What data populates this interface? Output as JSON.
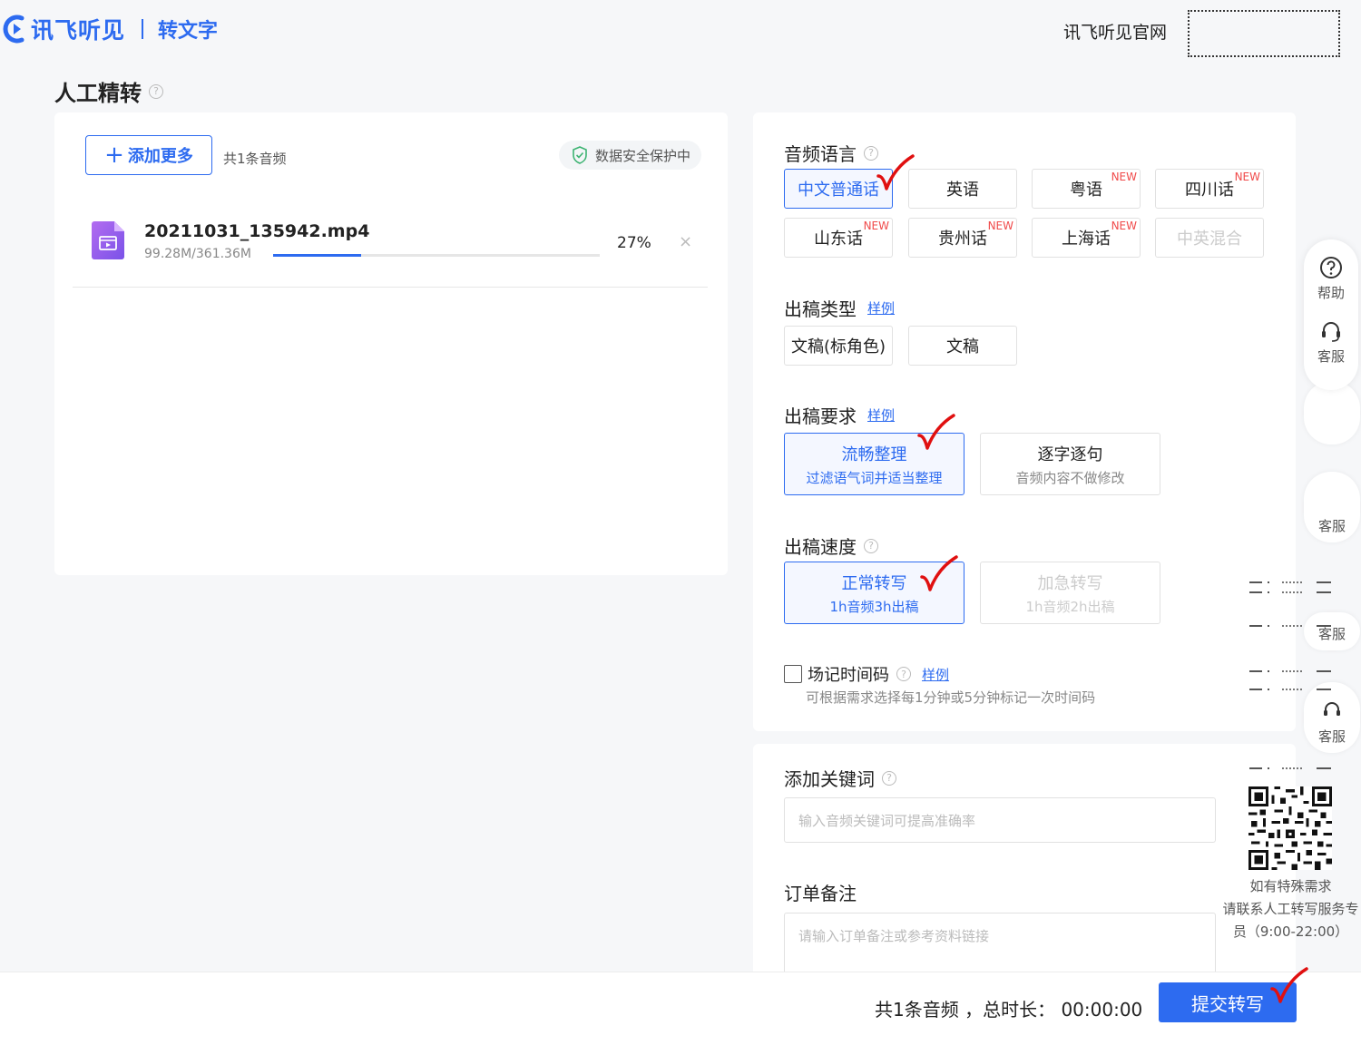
{
  "header": {
    "logo_text": "讯飞听见",
    "logo_sub": "转文字",
    "official_site": "讯飞听见官网"
  },
  "page": {
    "title": "人工精转",
    "help": "?"
  },
  "upload": {
    "add_more_plus": "+",
    "add_more": "添加更多",
    "count_label": "共1条音频",
    "secure_label": "数据安全保护中",
    "file": {
      "name": "20211031_135942.mp4",
      "size": "99.28M/361.36M",
      "progress_pct": "27%",
      "progress_value": 0.27,
      "close": "×"
    }
  },
  "audio_language": {
    "title": "音频语言",
    "help": "?",
    "options": [
      {
        "label": "中文普通话",
        "badge": ""
      },
      {
        "label": "英语",
        "badge": ""
      },
      {
        "label": "粤语",
        "badge": "NEW"
      },
      {
        "label": "四川话",
        "badge": "NEW"
      },
      {
        "label": "山东话",
        "badge": "NEW"
      },
      {
        "label": "贵州话",
        "badge": "NEW"
      },
      {
        "label": "上海话",
        "badge": "NEW"
      },
      {
        "label": "中英混合",
        "badge": ""
      }
    ]
  },
  "output_type": {
    "title": "出稿类型",
    "sample": "样例",
    "options": [
      "文稿(标角色)",
      "文稿"
    ]
  },
  "output_requirement": {
    "title": "出稿要求",
    "sample": "样例",
    "options": [
      {
        "title": "流畅整理",
        "sub": "过滤语气词并适当整理"
      },
      {
        "title": "逐字逐句",
        "sub": "音频内容不做修改"
      }
    ]
  },
  "output_speed": {
    "title": "出稿速度",
    "help": "?",
    "options": [
      {
        "title": "正常转写",
        "sub": "1h音频3h出稿"
      },
      {
        "title": "加急转写",
        "sub": "1h音频2h出稿"
      }
    ]
  },
  "timecode": {
    "label": "场记时间码",
    "help": "?",
    "sample": "样例",
    "hint": "可根据需求选择每1分钟或5分钟标记一次时间码"
  },
  "keywords": {
    "title": "添加关键词",
    "help": "?",
    "placeholder": "输入音频关键词可提高准确率"
  },
  "remark": {
    "title": "订单备注",
    "placeholder": "请输入订单备注或参考资料链接"
  },
  "sidebar": {
    "help": "帮助",
    "service": "客服",
    "ghost_labels": [
      "客服",
      "客服",
      "客服"
    ]
  },
  "qr": {
    "line1": "如有特殊需求",
    "line2": "请联系人工转写服务专",
    "line3": "员（9:00-22:00）"
  },
  "footer": {
    "summary": "共1条音频 ，总时长： 00:00:00",
    "submit": "提交转写"
  },
  "colors": {
    "accent": "#2d6bf0",
    "new_badge": "#f04a4a",
    "check": "#e01010"
  }
}
